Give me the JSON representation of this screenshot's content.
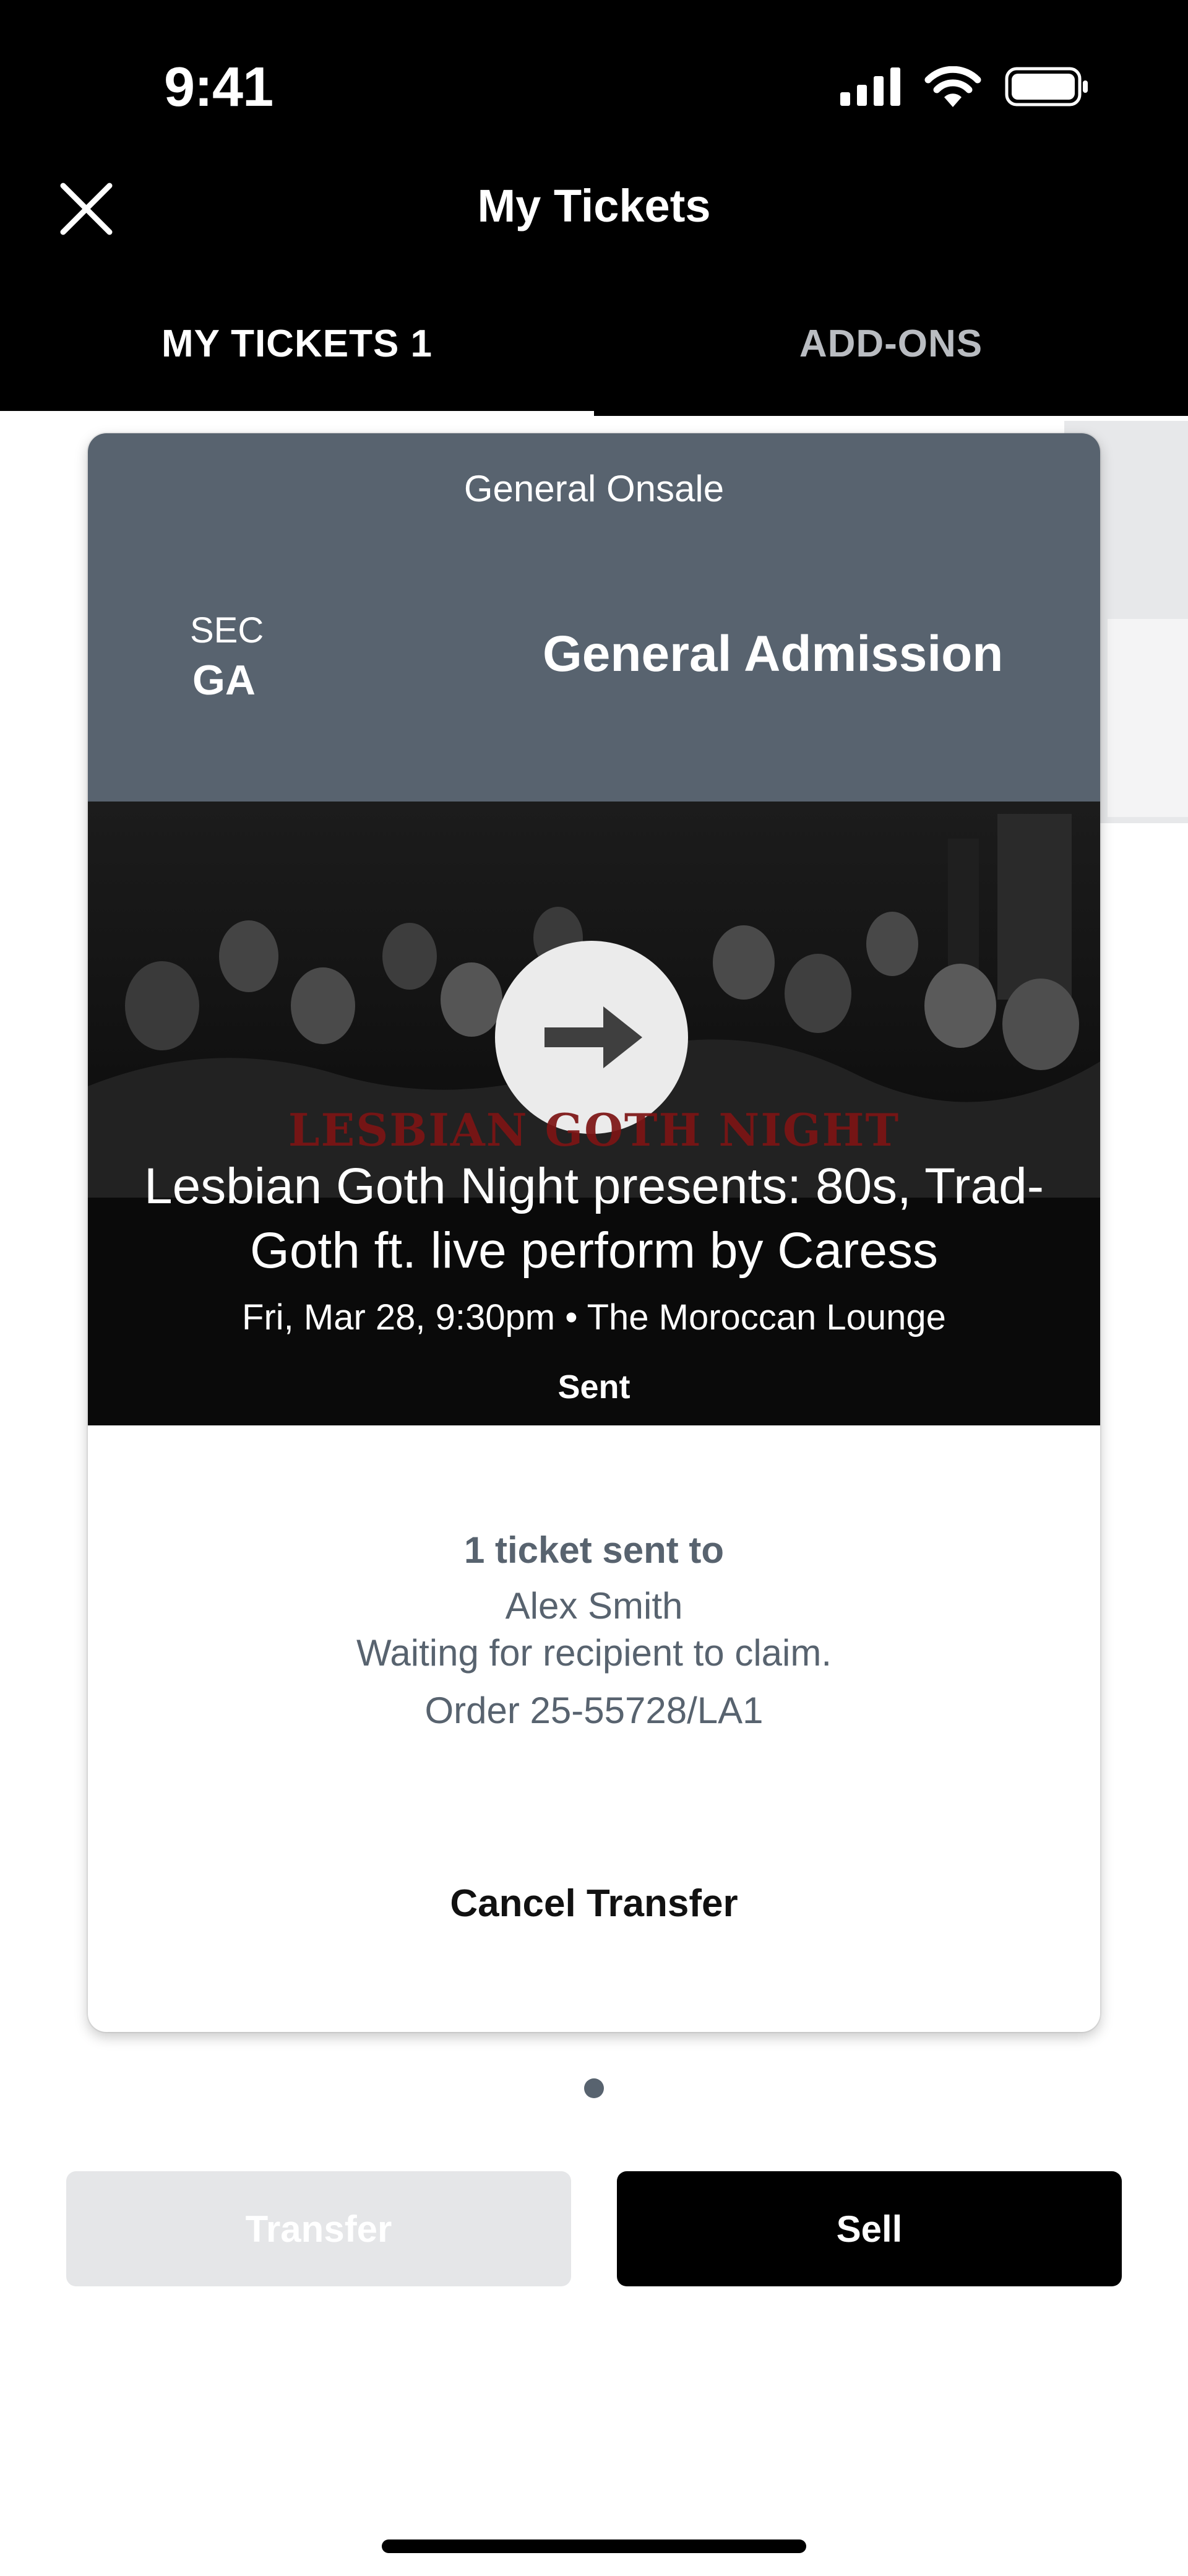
{
  "status_bar": {
    "time": "9:41"
  },
  "header": {
    "title": "My Tickets"
  },
  "tabs": [
    {
      "label": "MY TICKETS 1",
      "active": true
    },
    {
      "label": "ADD-ONS",
      "active": false
    }
  ],
  "ticket": {
    "onsale_label": "General Onsale",
    "section_label": "SEC",
    "section_value": "GA",
    "admission": "General Admission",
    "logo_text": "LESBIAN GOTH NIGHT",
    "event_title": "Lesbian Goth Night presents: 80s, Trad-Goth ft. live perform by Caress",
    "event_meta": "Fri, Mar 28, 9:30pm • The Moroccan Lounge",
    "status": "Sent",
    "transfer": {
      "heading": "1 ticket sent to",
      "recipient": "Alex Smith",
      "note": "Waiting for recipient to claim.",
      "order": "Order 25-55728/LA1",
      "cancel_label": "Cancel Transfer"
    }
  },
  "pagination": {
    "current": 1,
    "total": 1
  },
  "actions": {
    "transfer_label": "Transfer",
    "sell_label": "Sell"
  },
  "colors": {
    "header_bg": "#000000",
    "card_head": "#58636f",
    "accent_text": "#58636f",
    "logo_red": "#7d1414"
  }
}
